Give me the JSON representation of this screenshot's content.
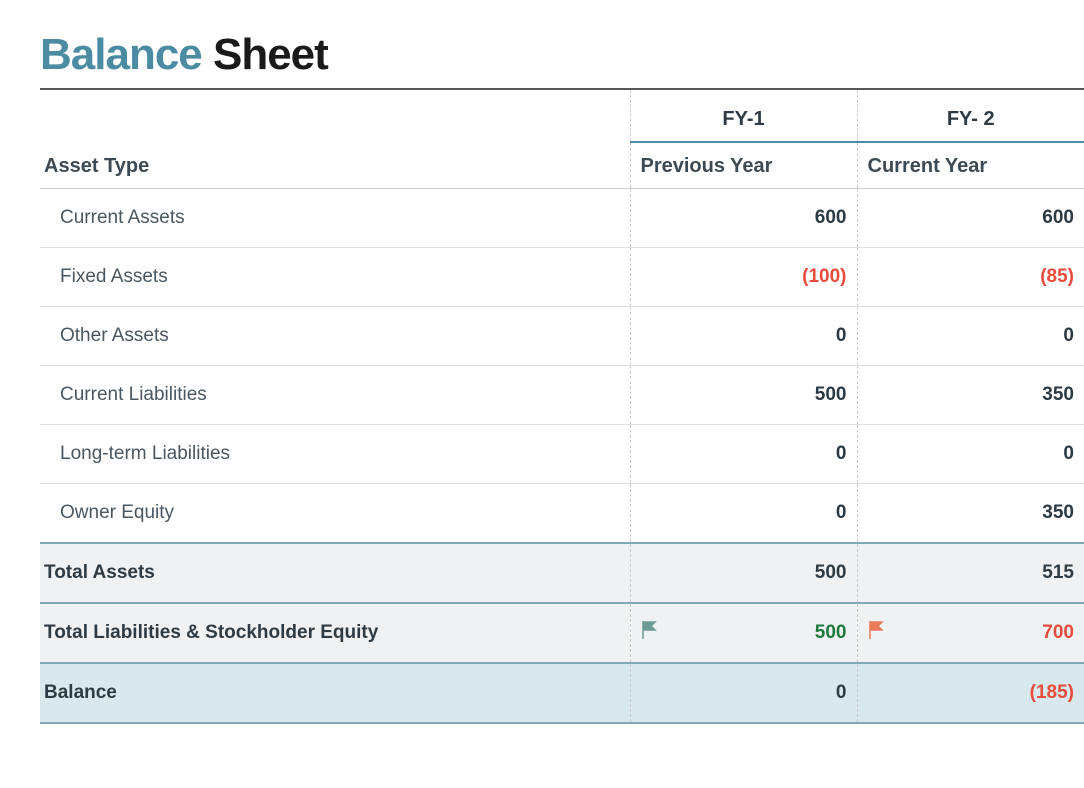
{
  "title": {
    "accent": "Balance",
    "rest": " Sheet"
  },
  "columns": {
    "asset_type": "Asset Type",
    "fy1": "FY-1",
    "fy2": "FY- 2",
    "prev": "Previous Year",
    "curr": "Current Year"
  },
  "rows": [
    {
      "label": "Current Assets",
      "prev": "600",
      "curr": "600",
      "prev_neg": false,
      "curr_neg": false
    },
    {
      "label": "Fixed Assets",
      "prev": "(100)",
      "curr": "(85)",
      "prev_neg": true,
      "curr_neg": true
    },
    {
      "label": "Other Assets",
      "prev": "0",
      "curr": "0",
      "prev_neg": false,
      "curr_neg": false
    },
    {
      "label": "Current Liabilities",
      "prev": "500",
      "curr": "350",
      "prev_neg": false,
      "curr_neg": false
    },
    {
      "label": "Long-term Liabilities",
      "prev": "0",
      "curr": "0",
      "prev_neg": false,
      "curr_neg": false
    },
    {
      "label": "Owner Equity",
      "prev": "0",
      "curr": "350",
      "prev_neg": false,
      "curr_neg": false
    }
  ],
  "total_assets": {
    "label": "Total Assets",
    "prev": "500",
    "curr": "515"
  },
  "total_liab": {
    "label": "Total Liabilities & Stockholder Equity",
    "prev": "500",
    "curr": "700"
  },
  "balance": {
    "label": "Balance",
    "prev": "0",
    "curr": "(185)",
    "curr_neg": true
  },
  "chart_data": {
    "type": "table",
    "title": "Balance Sheet",
    "categories": [
      "FY-1 (Previous Year)",
      "FY-2 (Current Year)"
    ],
    "series": [
      {
        "name": "Current Assets",
        "values": [
          600,
          600
        ]
      },
      {
        "name": "Fixed Assets",
        "values": [
          -100,
          -85
        ]
      },
      {
        "name": "Other Assets",
        "values": [
          0,
          0
        ]
      },
      {
        "name": "Current Liabilities",
        "values": [
          500,
          350
        ]
      },
      {
        "name": "Long-term Liabilities",
        "values": [
          0,
          0
        ]
      },
      {
        "name": "Owner Equity",
        "values": [
          0,
          350
        ]
      },
      {
        "name": "Total Assets",
        "values": [
          500,
          515
        ]
      },
      {
        "name": "Total Liabilities & Stockholder Equity",
        "values": [
          500,
          700
        ]
      },
      {
        "name": "Balance",
        "values": [
          0,
          -185
        ]
      }
    ]
  }
}
